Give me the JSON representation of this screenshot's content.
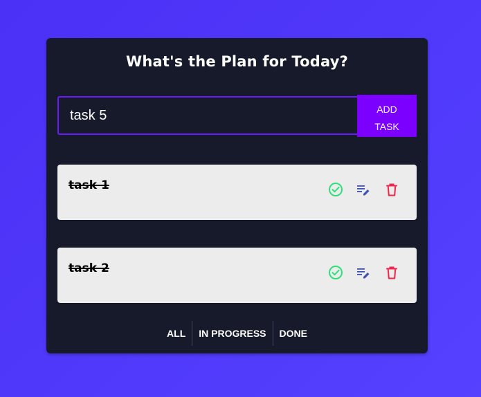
{
  "app": {
    "title": "What's the Plan for Today?"
  },
  "input": {
    "value": "task 5",
    "placeholder": ""
  },
  "add_button": {
    "line1": "ADD",
    "line2": "TASK"
  },
  "tasks": [
    {
      "text": "task 1",
      "completed": true,
      "icons": [
        "check-circle-icon",
        "edit-icon",
        "trash-icon"
      ]
    },
    {
      "text": "task 2",
      "completed": true,
      "icons": [
        "check-circle-icon",
        "edit-icon",
        "trash-icon"
      ]
    }
  ],
  "filters": [
    {
      "label": "ALL"
    },
    {
      "label": "IN PROGRESS"
    },
    {
      "label": "DONE"
    }
  ],
  "colors": {
    "background": "#5040fa",
    "card": "#161a2b",
    "accent": "#7b00ff",
    "task_bg": "#ececec",
    "done_icon": "#2ee07a",
    "edit_icon": "#3f51b5",
    "delete_icon": "#f0254a"
  }
}
